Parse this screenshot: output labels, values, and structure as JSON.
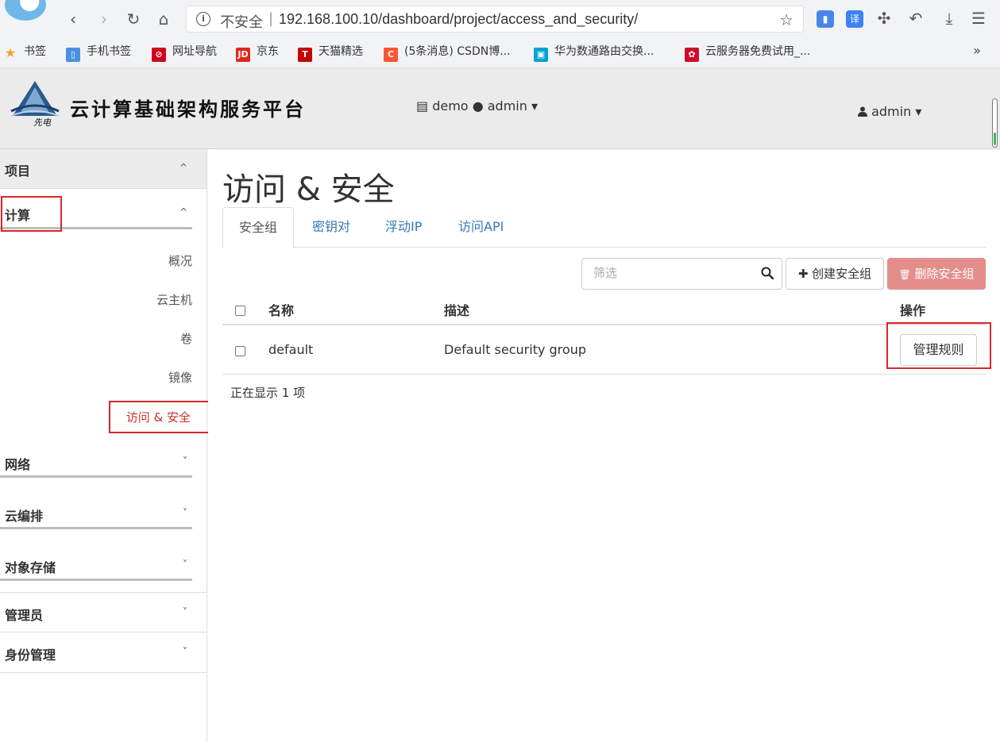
{
  "browser": {
    "nav_back": "‹",
    "nav_forward": "›",
    "nav_reload": "↻",
    "nav_home": "⌂",
    "insecure_label": "不安全",
    "url_separator": "|",
    "url": "192.168.100.10/dashboard/project/access_and_security/",
    "bookmark_star": "☆",
    "ext_translate": "译",
    "more": "»",
    "bookmarks": [
      {
        "label": "书签",
        "icon": "star-icon",
        "color": "#f5a623"
      },
      {
        "label": "手机书签",
        "icon": "phone-icon",
        "color": "#4a90e2"
      },
      {
        "label": "网址导航",
        "icon": "nav-icon",
        "color": "#d0021b"
      },
      {
        "label": "京东",
        "icon": "jd-icon",
        "color": "#e1251b"
      },
      {
        "label": "天猫精选",
        "icon": "tmall-icon",
        "color": "#c40000"
      },
      {
        "label": "(5条消息) CSDN博...",
        "icon": "csdn-icon",
        "color": "#fc5531"
      },
      {
        "label": "华为数通路由交换...",
        "icon": "bilibili-icon",
        "color": "#00a1d6"
      },
      {
        "label": "云服务器免费试用_...",
        "icon": "huawei-icon",
        "color": "#cf0a2c"
      }
    ]
  },
  "header": {
    "app_title": "云计算基础架构服务平台",
    "logo_caption": "先电",
    "project_icon": "▤",
    "project_name": "demo",
    "project_dot": "●",
    "project_user": "admin",
    "user_icon": "👤",
    "user_name": "admin",
    "caret": "▾"
  },
  "sidebar": {
    "project": {
      "label": "项目",
      "chevron": "^"
    },
    "compute": {
      "label": "计算",
      "chevron": "^"
    },
    "items": [
      {
        "label": "概况"
      },
      {
        "label": "云主机"
      },
      {
        "label": "卷"
      },
      {
        "label": "镜像"
      },
      {
        "label": "访问 & 安全"
      }
    ],
    "network": {
      "label": "网络",
      "chevron": "˅"
    },
    "orchestration": {
      "label": "云编排",
      "chevron": "˅"
    },
    "object_storage": {
      "label": "对象存储",
      "chevron": "˅"
    },
    "admin": {
      "label": "管理员",
      "chevron": "˅"
    },
    "identity": {
      "label": "身份管理",
      "chevron": "˅"
    }
  },
  "main": {
    "title": "访问 & 安全",
    "tabs": [
      {
        "label": "安全组",
        "active": true
      },
      {
        "label": "密钥对",
        "active": false
      },
      {
        "label": "浮动IP",
        "active": false
      },
      {
        "label": "访问API",
        "active": false
      }
    ],
    "filter_placeholder": "筛选",
    "create_button": "创建安全组",
    "create_icon": "✚",
    "delete_button": "删除安全组",
    "delete_icon": "🗑",
    "table": {
      "headers": {
        "name": "名称",
        "description": "描述",
        "actions": "操作"
      },
      "rows": [
        {
          "name": "default",
          "description": "Default security group",
          "action": "管理规则"
        }
      ]
    },
    "count_text": "正在显示 1 项"
  },
  "colors": {
    "highlight_box": "#d9262a",
    "link": "#337ab7",
    "danger_disabled": "#e48e8c",
    "active_nav": "#c9302c"
  }
}
